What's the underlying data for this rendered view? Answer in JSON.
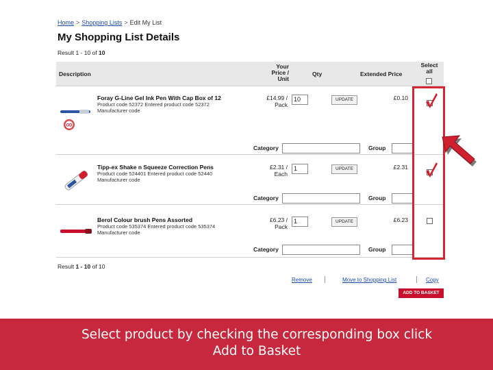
{
  "breadcrumb": {
    "home": "Home",
    "shopping_lists": "Shopping Lists",
    "current": "Edit My List",
    "separator": ">"
  },
  "page_title": "My Shopping List Details",
  "results": {
    "top_prefix": "Result 1 - 10 of",
    "top_total": "10",
    "bottom_prefix": "Result",
    "bottom_range": "1 - 10",
    "bottom_suffix": "of 10"
  },
  "table": {
    "headers": {
      "description": "Description",
      "price": "Your Price / Unit",
      "qty": "Qty",
      "extended": "Extended Price",
      "select_all": "Select all"
    },
    "products": [
      {
        "name": "Foray G-Line Gel Ink Pen With Cap Box of 12",
        "code": "Product code 52372  Entered product code 52372",
        "manufacturer": "Manufacturer code",
        "price": "£14.99 / Pack",
        "qty": "10",
        "update_label": "UPDATE",
        "extended_price": "£0.10",
        "selected": true,
        "badge": "OD"
      },
      {
        "name": "Tipp-ex Shake n Squeeze Correction Pens",
        "code": "Product code 524401 Entered product code 52440",
        "manufacturer": "Manufacturer code",
        "price": "£2.31 / Each",
        "qty": "1",
        "update_label": "UPDATE",
        "extended_price": "£2.31",
        "selected": true
      },
      {
        "name": "Berol Colour brush Pens Assorted",
        "code": "Product code 535374 Entered product code 535374",
        "manufacturer": "Manufacturer code",
        "price": "£6.23 / Pack",
        "qty": "1",
        "update_label": "UPDATE",
        "extended_price": "£6.23",
        "selected": false
      }
    ],
    "category_label": "Category",
    "group_label": "Group"
  },
  "actions": {
    "remove": "Remove",
    "move": "Move to Shopping List",
    "copy": "Copy",
    "add_to_basket": "ADD TO BASKET"
  },
  "instruction": {
    "line1": "Select product by checking the corresponding box click",
    "line2": "Add to Basket"
  },
  "colors": {
    "accent_red": "#c8102e",
    "banner_red": "#c8283e",
    "link_blue": "#1a4aa8",
    "checkmark_red": "#d0202e"
  },
  "icons": {
    "checkmark": "checkmark-icon",
    "pointer": "arrow-pointer-icon"
  }
}
